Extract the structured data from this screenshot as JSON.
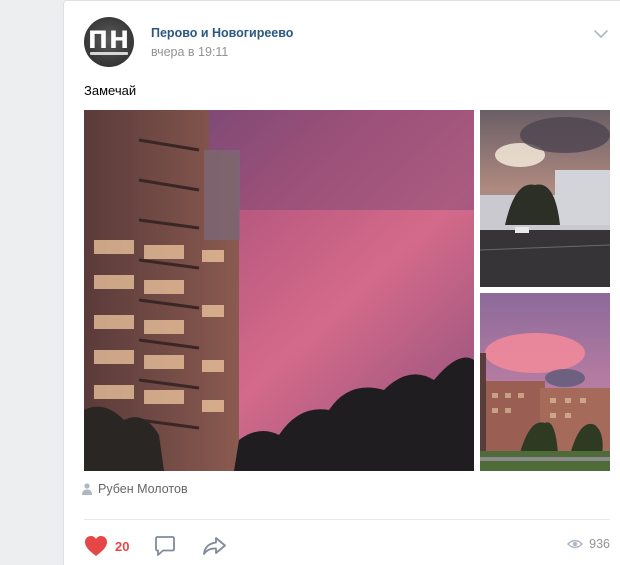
{
  "post": {
    "group_name": "Перово и Новогиреево",
    "avatar_text": "ПН",
    "time": "вчера в 19:11",
    "text": "Замечай",
    "author": "Рубен Молотов",
    "likes": "20",
    "views": "936"
  },
  "icons": {
    "menu": "chevron-down-icon",
    "like": "heart-icon",
    "comment": "comment-icon",
    "share": "share-icon",
    "views": "eye-icon",
    "author": "person-icon"
  },
  "colors": {
    "link": "#2a5885",
    "like_active": "#e64646",
    "muted": "#939393",
    "icon": "#828a99"
  }
}
